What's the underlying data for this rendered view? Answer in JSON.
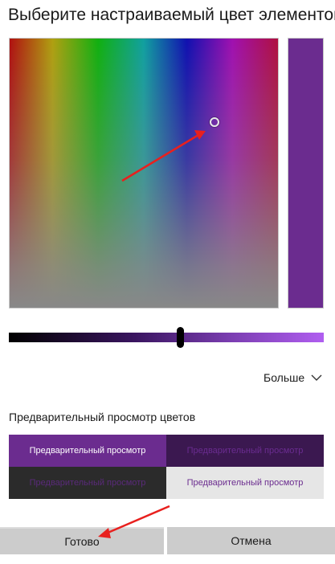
{
  "dialog": {
    "title": "Выберите настраиваемый цвет элементов"
  },
  "colors": {
    "selected": "#6b2c8f",
    "annotation_arrow": "#e8201e"
  },
  "more": {
    "label": "Больше",
    "icon": "chevron-down-icon"
  },
  "preview": {
    "heading": "Предварительный просмотр цветов",
    "cells": [
      "Предварительный просмотр",
      "Предварительный просмотр",
      "Предварительный просмотр",
      "Предварительный просмотр"
    ]
  },
  "buttons": {
    "ok": "Готово",
    "cancel": "Отмена"
  }
}
